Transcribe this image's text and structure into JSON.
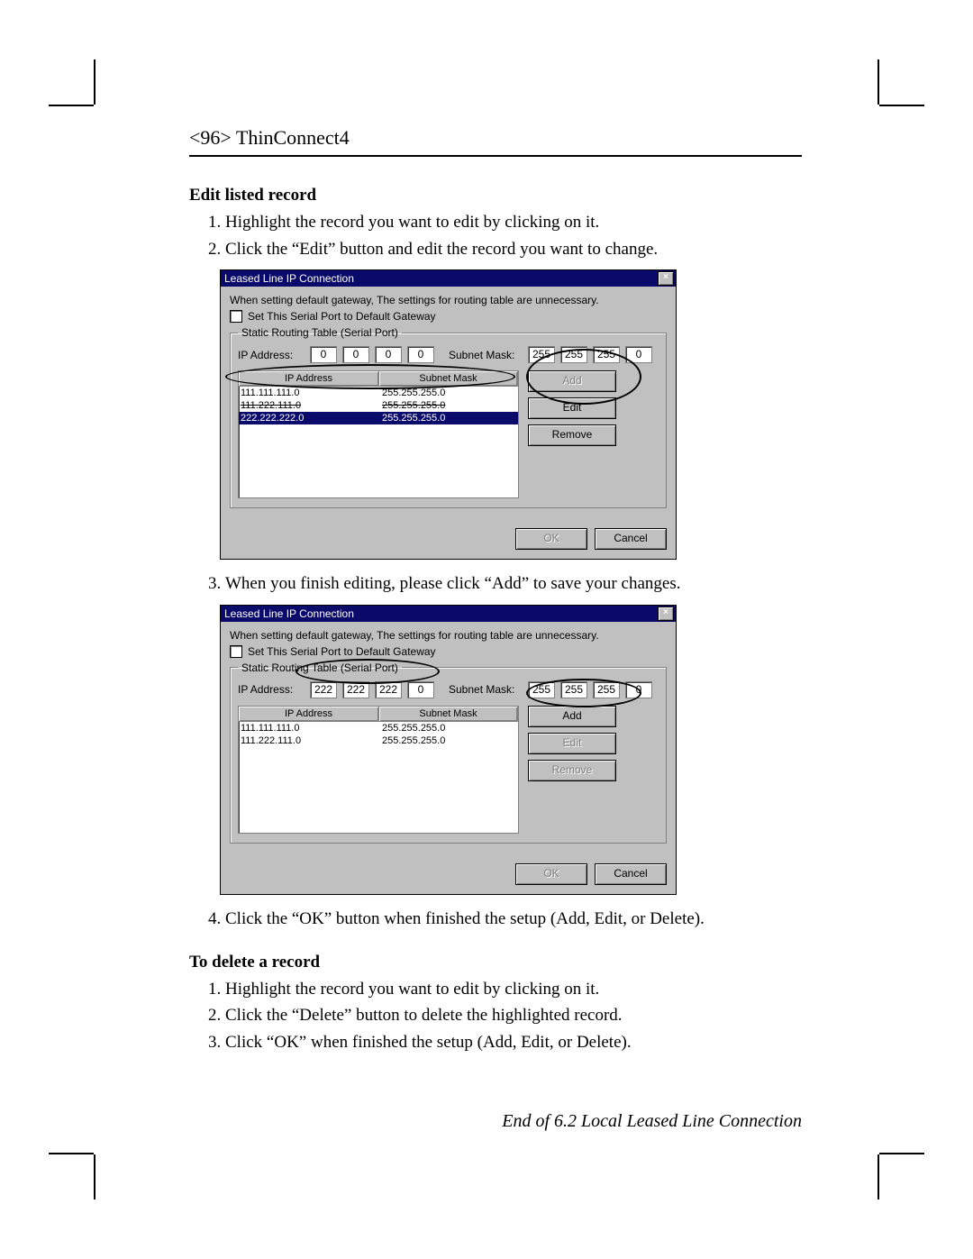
{
  "header": "<96> ThinConnect4",
  "sections": {
    "edit": {
      "title": "Edit listed record",
      "steps": [
        "Highlight the record you want to edit by clicking on it.",
        "Click the “Edit” button and edit the record you want to change.",
        "When you finish editing, please click “Add” to save your changes.",
        "Click the “OK” button when finished the setup (Add, Edit, or Delete)."
      ]
    },
    "delete": {
      "title": "To delete a record",
      "steps": [
        "Highlight the record you want to edit by clicking on it.",
        "Click the “Delete” button to delete the highlighted record.",
        "Click “OK” when finished the setup (Add, Edit, or Delete)."
      ]
    }
  },
  "end_note": "End of 6.2 Local Leased Line Connection",
  "dialog_common": {
    "title": "Leased Line IP Connection",
    "note": "When setting default gateway, The settings for routing table are unnecessary.",
    "checkbox_label": "Set This Serial Port to Default Gateway",
    "fieldset_legend": "Static Routing Table (Serial Port)",
    "ip_label": "IP Address:",
    "mask_label": "Subnet Mask:",
    "col_ip": "IP Address",
    "col_mask": "Subnet Mask",
    "btn_add": "Add",
    "btn_edit": "Edit",
    "btn_remove": "Remove",
    "btn_ok": "OK",
    "btn_cancel": "Cancel",
    "close_x": "×"
  },
  "dialog1": {
    "ip_octets": [
      "0",
      "0",
      "0",
      "0"
    ],
    "mask_octets": [
      "255",
      "255",
      "255",
      "0"
    ],
    "rows": [
      {
        "ip": "111.111.111.0",
        "mask": "255.255.255.0",
        "selected": false,
        "struck": false
      },
      {
        "ip": "111.222.111.0",
        "mask": "255.255.255.0",
        "selected": false,
        "struck": true
      },
      {
        "ip": "222.222.222.0",
        "mask": "255.255.255.0",
        "selected": true,
        "struck": false
      }
    ],
    "add_disabled": true,
    "edit_disabled": false,
    "remove_disabled": false,
    "ok_disabled": true
  },
  "dialog2": {
    "ip_octets": [
      "222",
      "222",
      "222",
      "0"
    ],
    "mask_octets": [
      "255",
      "255",
      "255",
      "0"
    ],
    "rows": [
      {
        "ip": "111.111.111.0",
        "mask": "255.255.255.0",
        "selected": false
      },
      {
        "ip": "111.222.111.0",
        "mask": "255.255.255.0",
        "selected": false
      }
    ],
    "add_disabled": false,
    "edit_disabled": true,
    "remove_disabled": true,
    "ok_disabled": true
  }
}
